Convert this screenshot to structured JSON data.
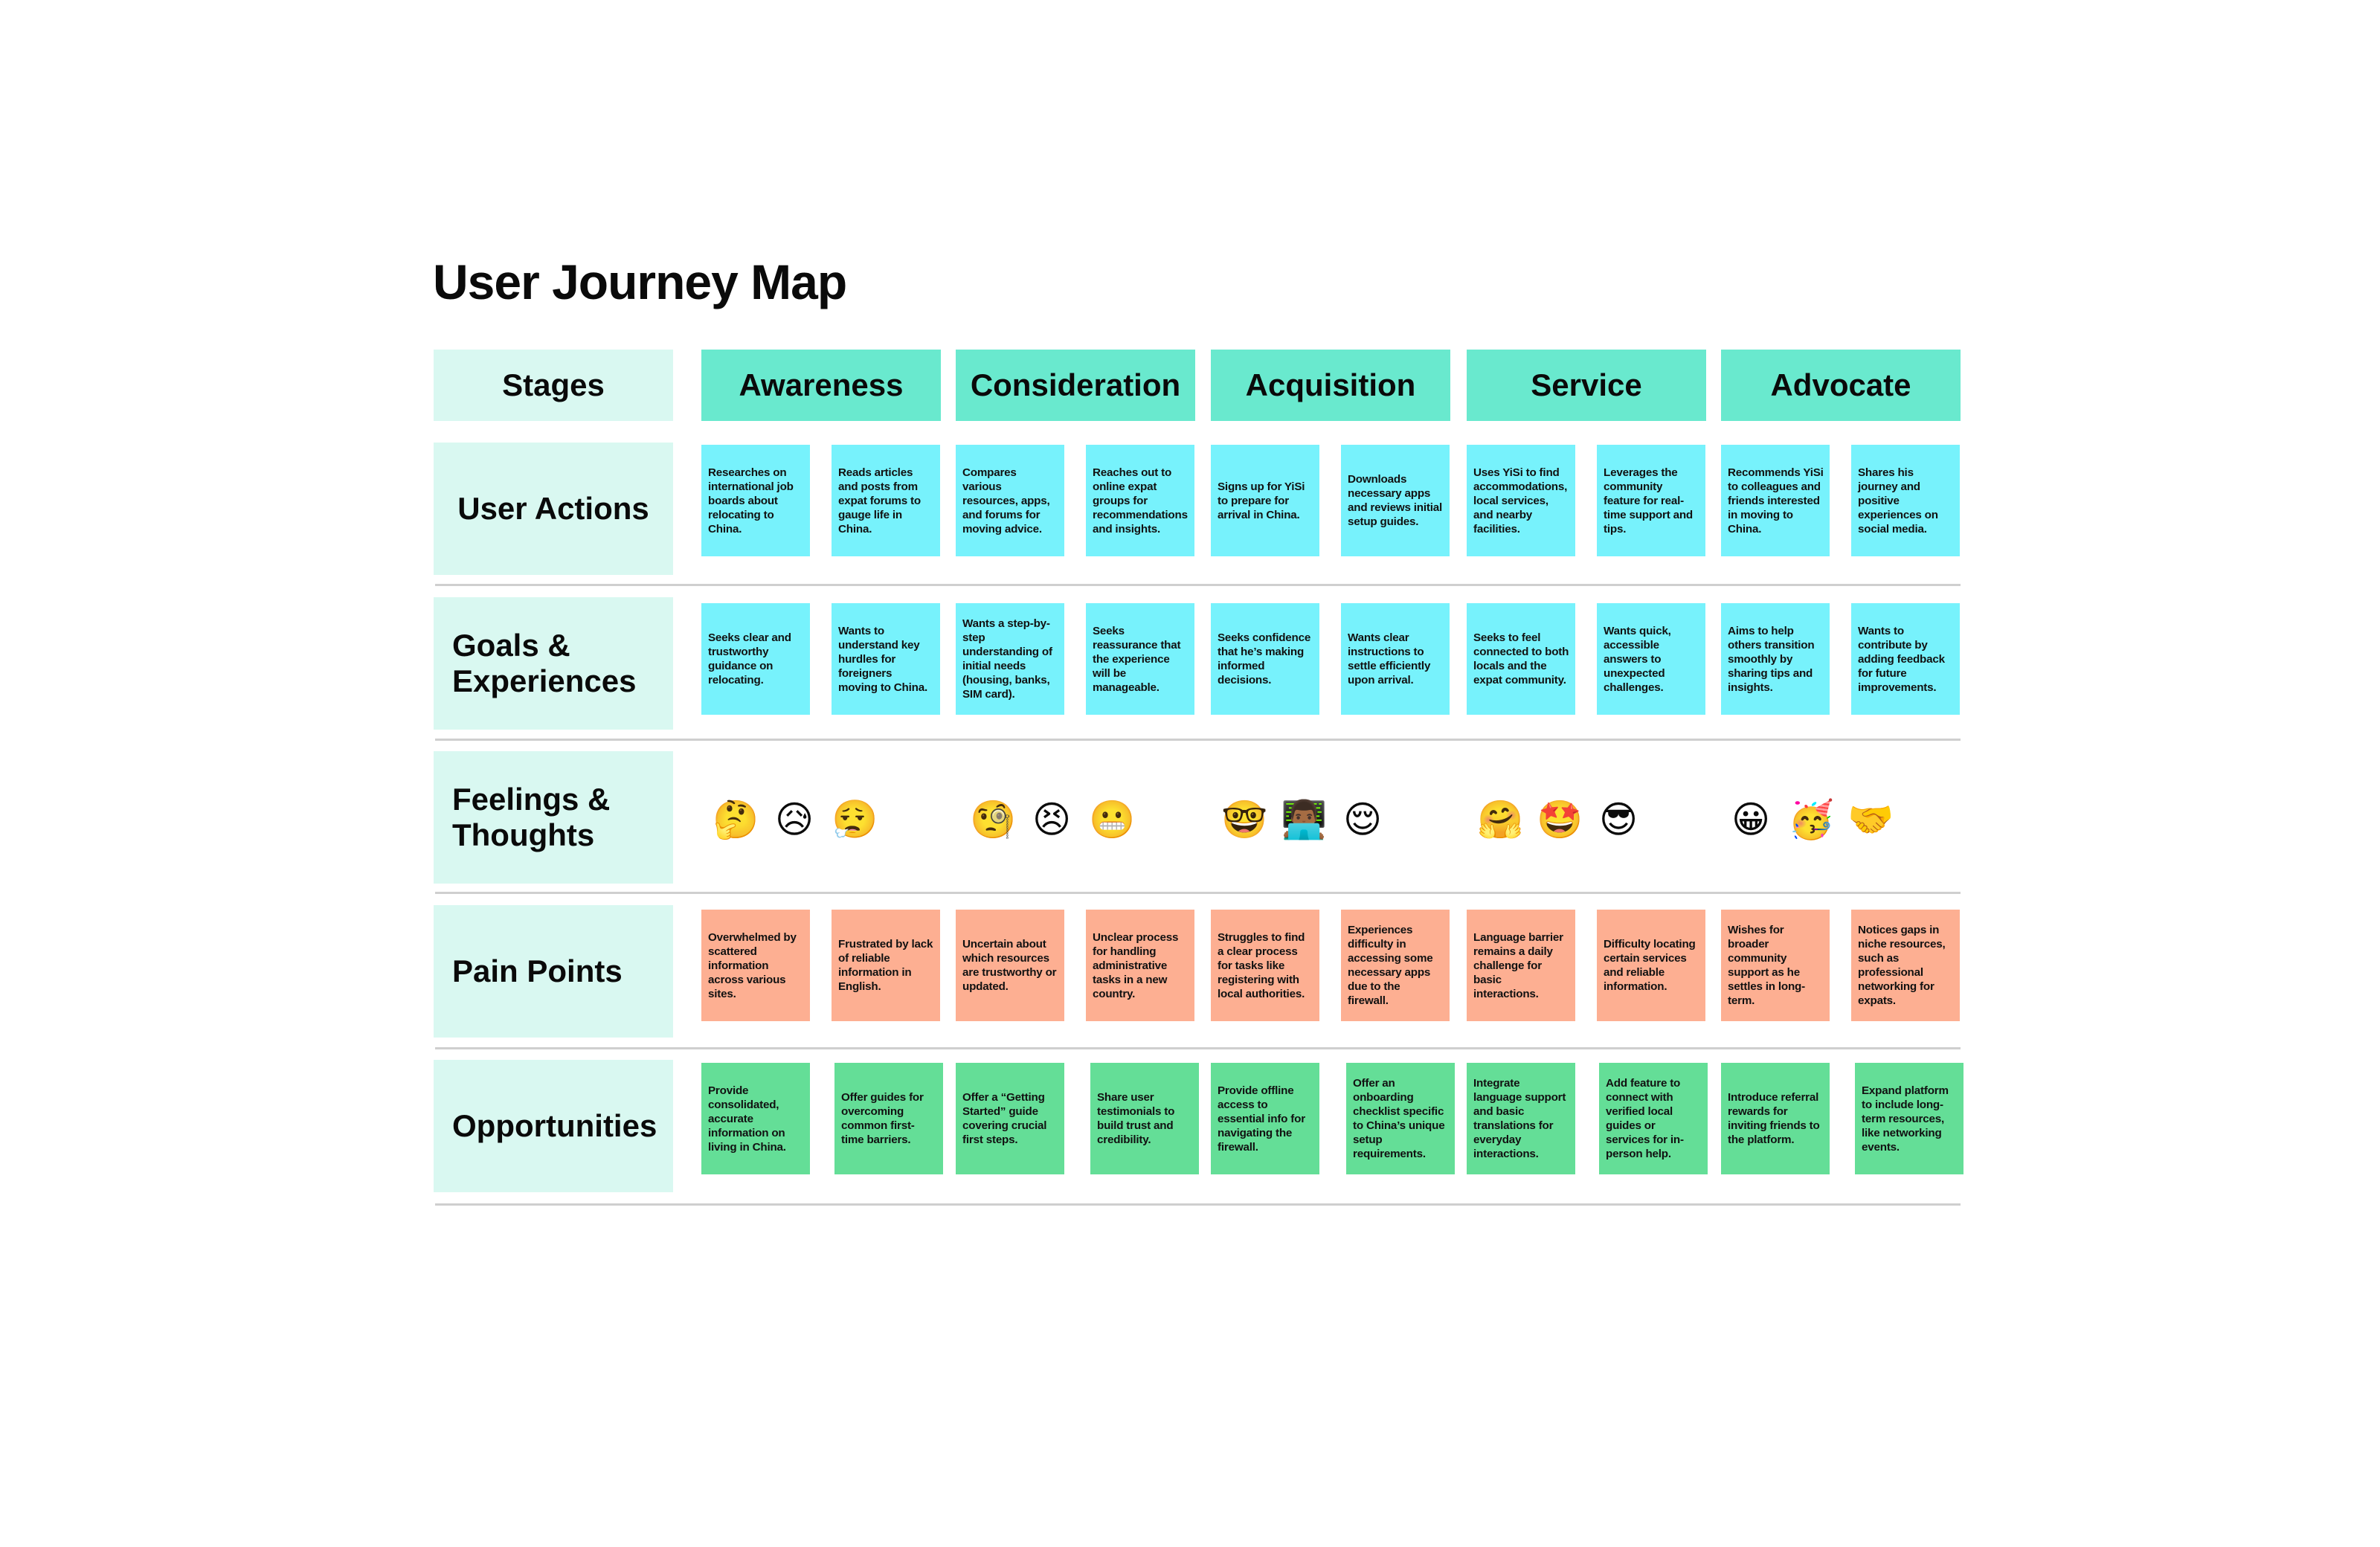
{
  "title": "User Journey Map",
  "colors": {
    "stage_header": "#69E9CE",
    "row_label_bg": "#D9F8F1",
    "actions_goals_note": "#77F2FC",
    "pain_note": "#FDAF92",
    "opportunity_note": "#64DE97",
    "divider": "#CFCFCF"
  },
  "stages_label": "Stages",
  "stages": [
    "Awareness",
    "Consideration",
    "Acquisition",
    "Service",
    "Advocate"
  ],
  "rows": {
    "user_actions": {
      "label": "User Actions",
      "notes": [
        "Researches on international job boards about relocating to China.",
        "Reads articles and posts from expat forums to gauge life in China.",
        "Compares various resources, apps, and forums for moving advice.",
        "Reaches out to online expat groups for recommendations and insights.",
        "Signs up for YiSi to prepare for arrival in China.",
        "Downloads necessary apps and reviews initial setup guides.",
        "Uses YiSi to find accommodations, local services, and nearby facilities.",
        "Leverages the community feature for real-time support and tips.",
        "Recommends YiSi to colleagues and friends interested in moving to China.",
        "Shares his journey and positive experiences on social media."
      ]
    },
    "goals": {
      "label": "Goals & Experiences",
      "notes": [
        "Seeks clear and trustworthy guidance on relocating.",
        "Wants to understand key hurdles for foreigners moving to China.",
        "Wants a step-by-step understanding of initial needs (housing, banks, SIM card).",
        "Seeks reassurance that the experience will be manageable.",
        "Seeks confidence that he’s making informed decisions.",
        "Wants clear instructions to settle efficiently upon arrival.",
        "Seeks to feel connected to both locals and the expat community.",
        "Wants quick, accessible answers to unexpected challenges.",
        "Aims to help others transition smoothly by sharing tips and insights.",
        "Wants to contribute by adding feedback for future improvements."
      ]
    },
    "feelings": {
      "label": "Feelings & Thoughts",
      "emojis": [
        {
          "name": "thinking-face-icon",
          "glyph": "🤔"
        },
        {
          "name": "sad-but-relieved-face-icon",
          "glyph": "😥"
        },
        {
          "name": "face-exhaling-icon",
          "glyph": "😮‍💨"
        },
        {
          "name": "face-with-monocle-icon",
          "glyph": "🧐"
        },
        {
          "name": "persevering-face-icon",
          "glyph": "😣"
        },
        {
          "name": "grimacing-face-icon",
          "glyph": "😬"
        },
        {
          "name": "nerd-face-icon",
          "glyph": "🤓"
        },
        {
          "name": "man-technologist-icon",
          "glyph": "👨🏾‍💻"
        },
        {
          "name": "relieved-face-icon",
          "glyph": "😌"
        },
        {
          "name": "hugging-face-icon",
          "glyph": "🤗"
        },
        {
          "name": "star-struck-icon",
          "glyph": "🤩"
        },
        {
          "name": "smiling-face-with-sunglasses-icon",
          "glyph": "😎"
        },
        {
          "name": "grinning-face-icon",
          "glyph": "😀"
        },
        {
          "name": "partying-face-icon",
          "glyph": "🥳"
        },
        {
          "name": "handshake-icon",
          "glyph": "🤝"
        }
      ]
    },
    "pain_points": {
      "label": "Pain Points",
      "notes": [
        "Overwhelmed by scattered information across various sites.",
        "Frustrated by lack of reliable information in English.",
        "Uncertain about which resources are trustworthy or updated.",
        "Unclear process for handling administrative tasks in a new country.",
        "Struggles to find a clear process for tasks like registering with local authorities.",
        "Experiences difficulty in accessing some necessary apps due to the firewall.",
        "Language barrier remains a daily challenge for basic interactions.",
        "Difficulty locating certain services and reliable information.",
        "Wishes for broader community support as he settles in long-term.",
        "Notices gaps in niche resources, such as professional networking for expats."
      ]
    },
    "opportunities": {
      "label": "Opportunities",
      "notes": [
        "Provide consolidated, accurate information on living in China.",
        "Offer guides for overcoming common first-time barriers.",
        "Offer a “Getting Started” guide covering crucial first steps.",
        "Share user testimonials to build trust and credibility.",
        "Provide offline access to essential info for navigating the firewall.",
        "Offer an onboarding checklist specific to China’s unique setup requirements.",
        "Integrate language support and basic translations for everyday interactions.",
        "Add feature to connect with verified local guides or services for in-person help.",
        "Introduce referral rewards for inviting friends to the platform.",
        "Expand platform to include long-term resources, like networking events."
      ]
    }
  }
}
